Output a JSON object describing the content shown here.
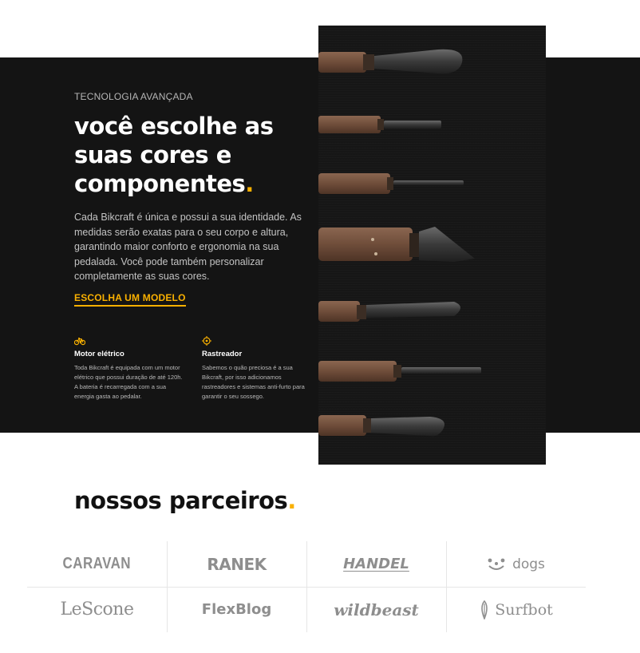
{
  "hero": {
    "eyebrow": "TECNOLOGIA AVANÇADA",
    "headline_line1": "você escolhe as",
    "headline_line2": "suas cores e",
    "headline_line3": "componentes",
    "headline_dot": ".",
    "lead": "Cada Bikcraft é única e possui a sua identidade. As medidas serão exatas para o seu corpo e altura, garantindo maior conforto e ergonomia na sua pedalada. Você pode também personalizar completamente as suas cores.",
    "cta": "ESCOLHA UM MODELO"
  },
  "features": [
    {
      "icon": "bike-icon",
      "title": "Motor elétrico",
      "text": "Toda Bikcraft é equipada com um motor elétrico que possui duração de até 120h. A bateria é recarregada com a sua energia gasta ao pedalar."
    },
    {
      "icon": "target-icon",
      "title": "Rastreador",
      "text": "Sabemos o quão preciosa é a sua Bikcraft, por isso adicionamos rastreadores e sistemas anti-furto para garantir o seu sossego."
    }
  ],
  "partners": {
    "title": "nossos parceiros",
    "title_dot": ".",
    "logos": [
      "CARAVAN",
      "RANEK",
      "HANDEL",
      "dogs",
      "LeScone",
      "FlexBlog",
      "wildbeast",
      "Surfbot"
    ]
  },
  "colors": {
    "accent": "#f9b000",
    "dark": "#141414",
    "logo_gray": "#8e8e8e"
  },
  "image": {
    "subject": "wood-handled chisels on black fabric"
  }
}
